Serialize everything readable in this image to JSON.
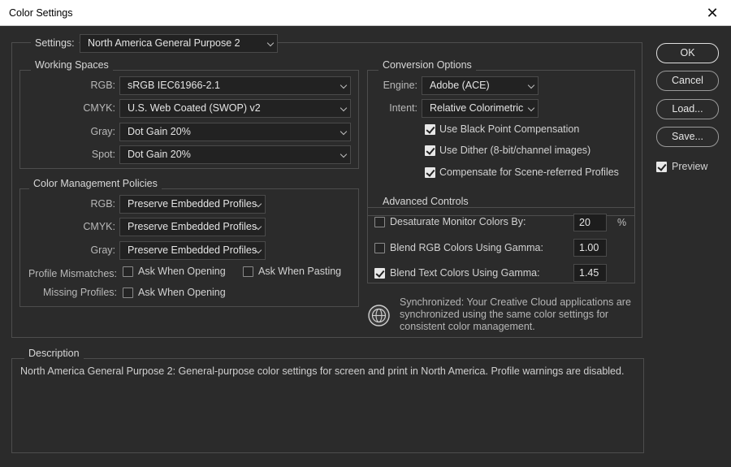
{
  "window": {
    "title": "Color Settings",
    "close_glyph": "✕"
  },
  "settings": {
    "label": "Settings:",
    "value": "North America General Purpose 2"
  },
  "working_spaces": {
    "title": "Working Spaces",
    "rgb": {
      "label": "RGB:",
      "value": "sRGB IEC61966-2.1"
    },
    "cmyk": {
      "label": "CMYK:",
      "value": "U.S. Web Coated (SWOP) v2"
    },
    "gray": {
      "label": "Gray:",
      "value": "Dot Gain 20%"
    },
    "spot": {
      "label": "Spot:",
      "value": "Dot Gain 20%"
    }
  },
  "policies": {
    "title": "Color Management Policies",
    "rgb": {
      "label": "RGB:",
      "value": "Preserve Embedded Profiles"
    },
    "cmyk": {
      "label": "CMYK:",
      "value": "Preserve Embedded Profiles"
    },
    "gray": {
      "label": "Gray:",
      "value": "Preserve Embedded Profiles"
    },
    "mismatch_label": "Profile Mismatches:",
    "ask_opening": {
      "label": "Ask When Opening",
      "checked": false
    },
    "ask_pasting": {
      "label": "Ask When Pasting",
      "checked": false
    },
    "missing_label": "Missing Profiles:",
    "missing_ask_opening": {
      "label": "Ask When Opening",
      "checked": false
    }
  },
  "conversion": {
    "title": "Conversion Options",
    "engine": {
      "label": "Engine:",
      "value": "Adobe (ACE)"
    },
    "intent": {
      "label": "Intent:",
      "value": "Relative Colorimetric"
    },
    "black_point": {
      "label": "Use Black Point Compensation",
      "checked": true
    },
    "dither": {
      "label": "Use Dither (8-bit/channel images)",
      "checked": true
    },
    "scene_referred": {
      "label": "Compensate for Scene-referred Profiles",
      "checked": true
    }
  },
  "advanced": {
    "title": "Advanced Controls",
    "desaturate": {
      "label": "Desaturate Monitor Colors By:",
      "checked": false,
      "value": "20",
      "unit": "%"
    },
    "blend_rgb": {
      "label": "Blend RGB Colors Using Gamma:",
      "checked": false,
      "value": "1.00"
    },
    "blend_text": {
      "label": "Blend Text Colors Using Gamma:",
      "checked": true,
      "value": "1.45"
    }
  },
  "sync": {
    "text": "Synchronized: Your Creative Cloud applications are synchronized using the same color settings for consistent color management.",
    "icon": "sync-globe-icon"
  },
  "description": {
    "title": "Description",
    "text": "North America General Purpose 2:  General-purpose color settings for screen and print in North America. Profile warnings are disabled."
  },
  "buttons": {
    "ok": "OK",
    "cancel": "Cancel",
    "load": "Load...",
    "save": "Save..."
  },
  "preview": {
    "label": "Preview",
    "checked": true
  }
}
